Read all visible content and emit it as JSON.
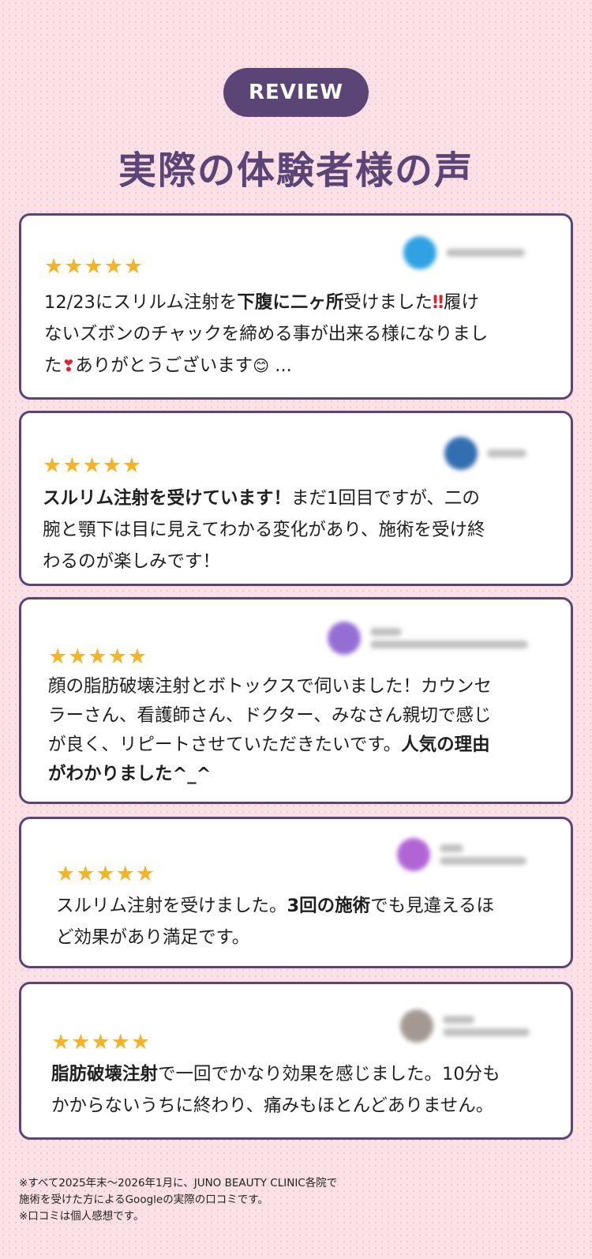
{
  "badge": "REVIEW",
  "title": "実際の体験者様の声",
  "stars": "★★★★★",
  "colors": {
    "accent": "#5b4576",
    "star": "#f4b42a",
    "background": "#fbe0e6"
  },
  "reviews": [
    {
      "avatar_color": "#1a98e0",
      "lines": [
        [
          "12/23にスリルム注射を",
          "下腹に二ヶ所",
          "受けました",
          "‼",
          "履け"
        ],
        "ないズボンのチャックを締める事が出来る様になりまし",
        [
          "た",
          "❣",
          "ありがとうございます",
          "😊",
          " ..."
        ]
      ]
    },
    {
      "avatar_color": "#1e5fa8",
      "lines": [
        [
          "スルリム注射を受けています！",
          "まだ1回目ですが、二の"
        ],
        "腕と顎下は目に見えてわかる変化があり、施術を受け終",
        "わるのが楽しみです！"
      ]
    },
    {
      "avatar_color": "#8a5fd0",
      "lines": [
        "顔の脂肪破壊注射とボトックスで伺いました！カウンセ",
        "ラーさん、看護師さん、ドクター、みなさん親切で感じ",
        [
          "が良く、リピートさせていただきたいです。",
          "人気の理由"
        ],
        "がわかりました^_^"
      ]
    },
    {
      "avatar_color": "#a855d0",
      "lines": [
        [
          "スルリム注射を受けました。",
          "3回の施術",
          "でも見違えるほ"
        ],
        "ど効果があり満足です。"
      ]
    },
    {
      "avatar_color": "#9a8f87",
      "lines": [
        [
          "脂肪破壊注射",
          "で一回でかなり効果を感じました。10分も"
        ],
        "かからないうちに終わり、痛みもほとんどありません。"
      ]
    }
  ],
  "footnote": [
    "※すべて2025年末〜2026年1月に、JUNO BEAUTY CLINIC各院で",
    "施術を受けた方によるGoogleの実際の口コミです。",
    "※口コミは個人感想です。"
  ]
}
